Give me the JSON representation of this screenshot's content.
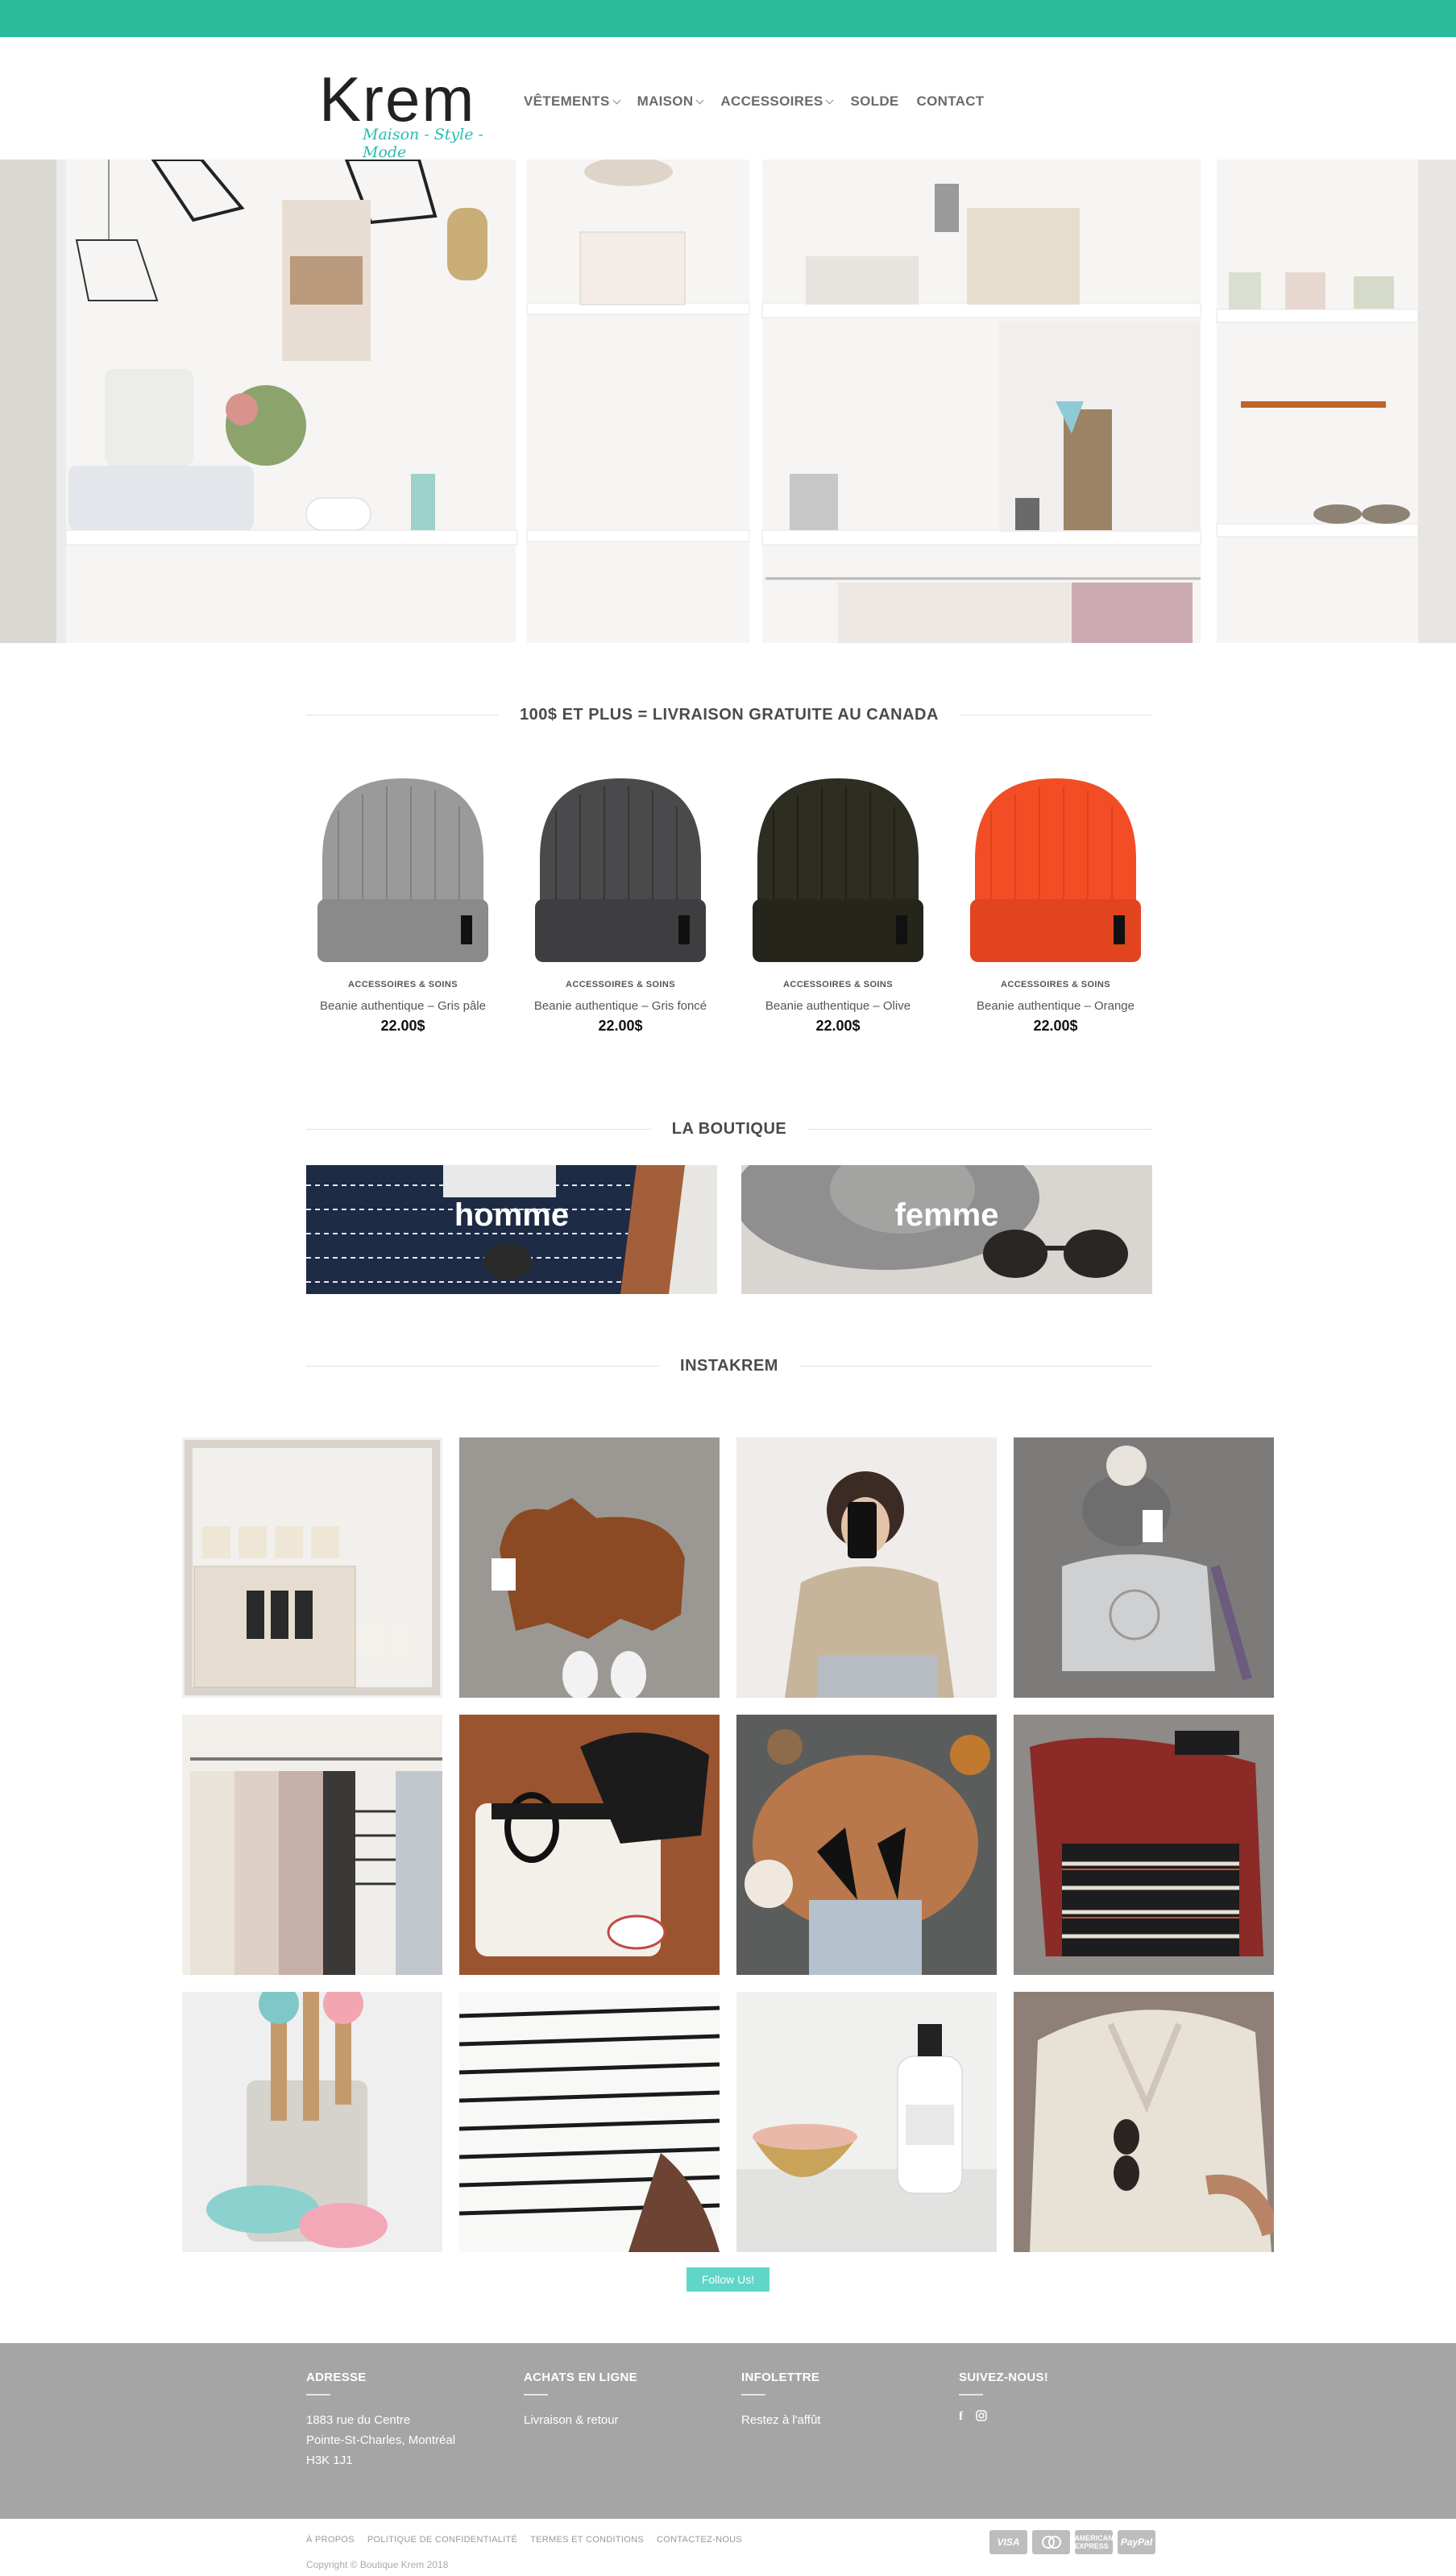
{
  "header": {
    "logo_text": "Krem",
    "logo_tagline": "Maison - Style - Mode",
    "nav": [
      {
        "label": "VÊTEMENTS",
        "has_dropdown": true
      },
      {
        "label": "MAISON",
        "has_dropdown": true
      },
      {
        "label": "ACCESSOIRES",
        "has_dropdown": true
      },
      {
        "label": "SOLDE",
        "has_dropdown": false
      },
      {
        "label": "CONTACT",
        "has_dropdown": false
      }
    ]
  },
  "colors": {
    "accent": "#2bbc9b",
    "footer": "#a5a5a5",
    "follow_button": "#5fd6c7"
  },
  "shipping_banner": "100$ ET PLUS = LIVRAISON GRATUITE AU CANADA",
  "products": [
    {
      "category": "ACCESSOIRES & SOINS",
      "name": "Beanie authentique – Gris pâle",
      "price": "22.00$",
      "color": "#9a9a9a"
    },
    {
      "category": "ACCESSOIRES & SOINS",
      "name": "Beanie authentique – Gris foncé",
      "price": "22.00$",
      "color": "#4a4a4c"
    },
    {
      "category": "ACCESSOIRES & SOINS",
      "name": "Beanie authentique – Olive",
      "price": "22.00$",
      "color": "#2e2d22"
    },
    {
      "category": "ACCESSOIRES & SOINS",
      "name": "Beanie authentique – Orange",
      "price": "22.00$",
      "color": "#f24d25"
    }
  ],
  "boutique": {
    "title": "LA BOUTIQUE",
    "cards": [
      {
        "label": "homme"
      },
      {
        "label": "femme"
      }
    ]
  },
  "instakrem": {
    "title": "INSTAKREM",
    "follow_label": "Follow Us!"
  },
  "footer": {
    "address": {
      "title": "ADRESSE",
      "lines": [
        "1883 rue du Centre",
        "Pointe-St-Charles, Montréal",
        "H3K 1J1"
      ]
    },
    "online": {
      "title": "ACHATS EN LIGNE",
      "link": "Livraison & retour"
    },
    "newsletter": {
      "title": "INFOLETTRE",
      "link": "Restez à l'affût"
    },
    "social": {
      "title": "SUIVEZ-NOUS!",
      "icons": [
        "facebook-icon",
        "instagram-icon"
      ]
    },
    "links": [
      "À PROPOS",
      "POLITIQUE DE CONFIDENTIALITÉ",
      "TERMES ET CONDITIONS",
      "CONTACTEZ-NOUS"
    ],
    "copyright": "Copyright © Boutique Krem 2018",
    "payment_cards": [
      "VISA",
      "MC",
      "AMEX",
      "PayPal"
    ]
  }
}
